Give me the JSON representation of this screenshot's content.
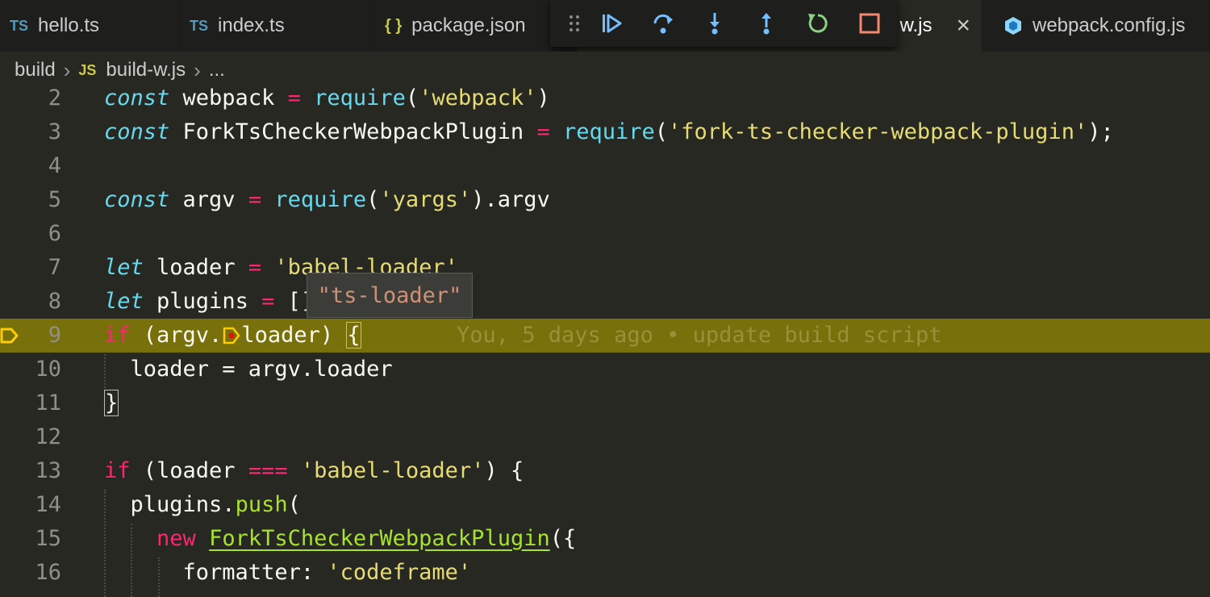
{
  "tabs": [
    {
      "badge": "TS",
      "label": "hello.ts"
    },
    {
      "badge": "TS",
      "label": "index.ts"
    },
    {
      "badge": "{ }",
      "label": "package.json"
    },
    {
      "badge": "",
      "label": "w.js",
      "close": "×"
    },
    {
      "badge": "",
      "label": "webpack.config.js"
    }
  ],
  "breadcrumb": {
    "folder": "build",
    "badge": "JS",
    "file": "build-w.js",
    "more": "..."
  },
  "debug_toolbar": [
    "continue-icon",
    "step-over-icon",
    "step-into-icon",
    "step-out-icon",
    "restart-icon",
    "stop-icon"
  ],
  "colors": {
    "current_line": "#78700b",
    "keyword": "#66d9ef",
    "operator": "#f92672",
    "string": "#e6db74",
    "class": "#a6e22e",
    "breakpoint": "#ffcc00"
  },
  "code": {
    "line_numbers": [
      "2",
      "3",
      "4",
      "5",
      "6",
      "7",
      "8",
      "9",
      "10",
      "11",
      "12",
      "13",
      "14",
      "15",
      "16"
    ],
    "l2": {
      "kw": "const",
      "name": " webpack ",
      "op": "=",
      "sp": " ",
      "fn": "require",
      "p1": "(",
      "str": "'webpack'",
      "p2": ")"
    },
    "l3": {
      "kw": "const",
      "name": " ForkTsCheckerWebpackPlugin ",
      "op": "=",
      "sp": " ",
      "fn": "require",
      "p1": "(",
      "str": "'fork-ts-checker-webpack-plugin'",
      "p2": ");"
    },
    "l5": {
      "kw": "const",
      "name": " argv ",
      "op": "=",
      "sp": " ",
      "fn": "require",
      "p1": "(",
      "str": "'yargs'",
      "p2": ").argv"
    },
    "l7": {
      "kw": "let",
      "name": " loader ",
      "op": "=",
      "sp": " ",
      "str": "'babel-loader'"
    },
    "l8": {
      "kw": "let",
      "name": " plugins ",
      "op": "=",
      "rest": " []"
    },
    "l9": {
      "kw": "if",
      "a": " (argv.",
      "b": "loader) ",
      "brace": "{",
      "blame": "You, 5 days ago • update build script"
    },
    "l10": {
      "text": "  loader = argv.loader"
    },
    "l11": {
      "brace": "}"
    },
    "l13": {
      "kw": "if",
      "a": " (loader ",
      "op": "===",
      "sp": " ",
      "str": "'babel-loader'",
      "rest": ") {"
    },
    "l14": {
      "a": "  plugins.",
      "fn": "push",
      "rest": "("
    },
    "l15": {
      "a": "    ",
      "kw": "new",
      "sp": " ",
      "cls": "ForkTsCheckerWebpackPlugin",
      "rest": "({"
    },
    "l16": {
      "a": "      formatter: ",
      "str": "'codeframe'"
    }
  },
  "hover": {
    "value": "\"ts-loader\""
  }
}
